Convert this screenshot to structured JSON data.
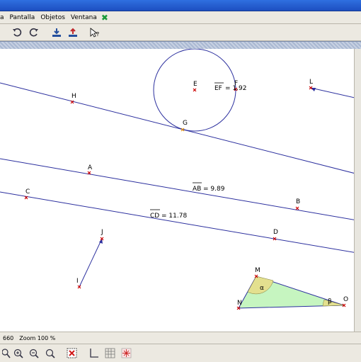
{
  "menubar": {
    "items": [
      "a",
      "Pantalla",
      "Objetos",
      "Ventana"
    ]
  },
  "toolbar": {
    "icons": [
      "undo-icon",
      "redo-icon",
      "download-icon",
      "upload-icon",
      "pointer-help-icon"
    ]
  },
  "canvas": {
    "points": [
      "A",
      "B",
      "C",
      "D",
      "E",
      "F",
      "G",
      "H",
      "I",
      "J",
      "L",
      "M",
      "N",
      "O"
    ],
    "measurements": {
      "ab": {
        "segment": "AB",
        "value": "= 9.89"
      },
      "cd": {
        "segment": "CD",
        "value": "= 11.78"
      },
      "ef": {
        "segment": "EF",
        "value": "= 1.92"
      }
    },
    "angles": {
      "alpha": "α",
      "beta": "β"
    }
  },
  "status": {
    "coord": "660",
    "zoom": "Zoom 100 %"
  },
  "bottom_toolbar": {
    "icons": [
      "zoom-window-icon",
      "zoom-in-icon",
      "zoom-out-icon",
      "zoom-fit-icon",
      "delete-icon",
      "axes-icon",
      "grid-icon",
      "point-grid-icon"
    ]
  },
  "colors": {
    "line": "#2b2f9e",
    "point": "#cc0000",
    "triangle_fill": "#c6f5c0",
    "angle_fill": "#e3e08f"
  }
}
